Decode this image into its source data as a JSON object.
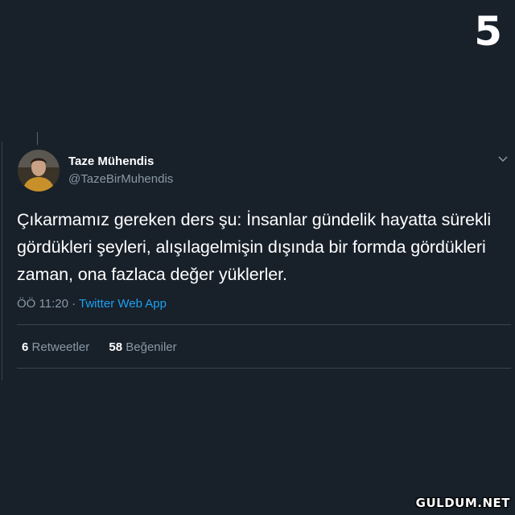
{
  "overlay": {
    "number": "5",
    "watermark": "GULDUM.NET"
  },
  "tweet": {
    "author": {
      "display_name": "Taze Mühendis",
      "handle": "@TazeBirMuhendis"
    },
    "text": "Çıkarmamız gereken ders şu: İnsanlar gündelik hayatta sürekli gördükleri şeyleri, alışılagelmişin dışında bir formda gördükleri zaman, ona fazlaca değer yüklerler.",
    "time": "ÖÖ 11:20",
    "separator": "·",
    "source": "Twitter Web App",
    "retweets": {
      "count": "6",
      "label": "Retweetler"
    },
    "likes": {
      "count": "58",
      "label": "Beğeniler"
    }
  },
  "colors": {
    "background": "#18202a",
    "text_primary": "#ffffff",
    "text_secondary": "#8899a6",
    "link": "#1da1f2",
    "divider": "#38444d"
  },
  "icons": {
    "menu": "chevron-down-icon"
  }
}
